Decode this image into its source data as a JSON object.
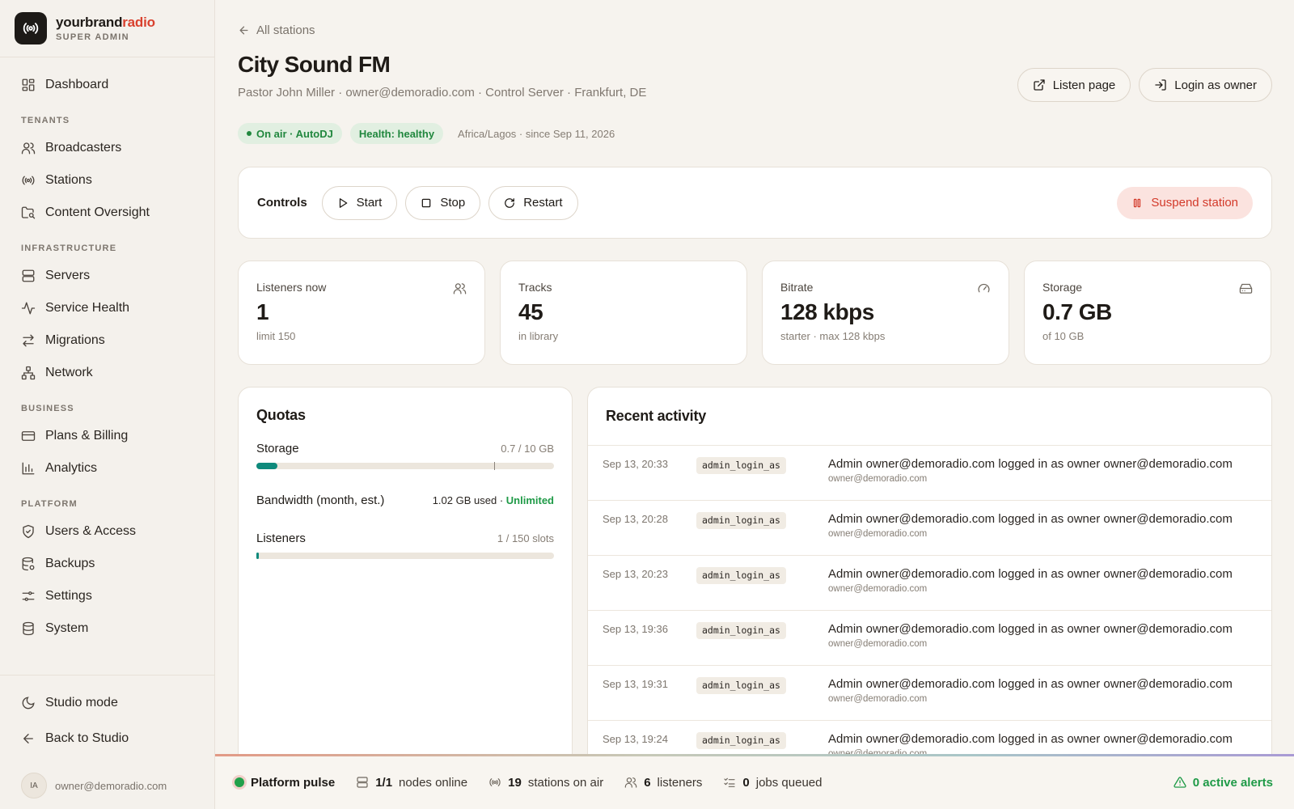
{
  "brand": {
    "name_main": "yourbrand",
    "name_accent": "radio",
    "role": "SUPER ADMIN"
  },
  "sidebar": {
    "top": [
      {
        "label": "Dashboard",
        "icon": "grid-icon"
      }
    ],
    "sections": [
      {
        "title": "TENANTS",
        "items": [
          {
            "label": "Broadcasters",
            "icon": "users-icon"
          },
          {
            "label": "Stations",
            "icon": "radio-icon"
          },
          {
            "label": "Content Oversight",
            "icon": "folder-search-icon"
          }
        ]
      },
      {
        "title": "INFRASTRUCTURE",
        "items": [
          {
            "label": "Servers",
            "icon": "server-icon"
          },
          {
            "label": "Service Health",
            "icon": "activity-icon"
          },
          {
            "label": "Migrations",
            "icon": "arrows-swap-icon"
          },
          {
            "label": "Network",
            "icon": "network-icon"
          }
        ]
      },
      {
        "title": "BUSINESS",
        "items": [
          {
            "label": "Plans & Billing",
            "icon": "credit-card-icon"
          },
          {
            "label": "Analytics",
            "icon": "bar-chart-icon"
          }
        ]
      },
      {
        "title": "PLATFORM",
        "items": [
          {
            "label": "Users & Access",
            "icon": "shield-icon"
          },
          {
            "label": "Backups",
            "icon": "database-backup-icon"
          },
          {
            "label": "Settings",
            "icon": "sliders-icon"
          },
          {
            "label": "System",
            "icon": "database-icon"
          }
        ]
      }
    ],
    "bottom": [
      {
        "label": "Studio mode",
        "icon": "moon-icon"
      },
      {
        "label": "Back to Studio",
        "icon": "arrow-left-icon"
      }
    ],
    "user": {
      "initials": "IA",
      "email": "owner@demoradio.com"
    }
  },
  "page": {
    "back_label": "All stations",
    "title": "City Sound FM",
    "subtitle": "Pastor John Miller · owner@demoradio.com · Control Server · Frankfurt, DE",
    "actions": {
      "listen": "Listen page",
      "login_as": "Login as owner"
    },
    "badges": {
      "on_air": "On air · AutoDJ",
      "health": "Health: healthy",
      "timezone": "Africa/Lagos · since Sep 11, 2026"
    },
    "controls": {
      "label": "Controls",
      "start": "Start",
      "stop": "Stop",
      "restart": "Restart",
      "suspend": "Suspend station"
    }
  },
  "stats": [
    {
      "label": "Listeners now",
      "value": "1",
      "sub": "limit 150",
      "icon": "users-icon"
    },
    {
      "label": "Tracks",
      "value": "45",
      "sub": "in library",
      "icon": ""
    },
    {
      "label": "Bitrate",
      "value": "128 kbps",
      "sub": "starter · max 128 kbps",
      "icon": "gauge-icon"
    },
    {
      "label": "Storage",
      "value": "0.7 GB",
      "sub": "of 10 GB",
      "icon": "hard-drive-icon"
    }
  ],
  "quotas": {
    "title": "Quotas",
    "storage": {
      "name": "Storage",
      "value": "0.7 / 10 GB",
      "fill_fraction": 0.07,
      "marker_fraction": 0.8
    },
    "bandwidth": {
      "name": "Bandwidth (month, est.)",
      "used": "1.02 GB used",
      "sep": " · ",
      "limit": "Unlimited"
    },
    "listeners": {
      "name": "Listeners",
      "value": "1 / 150 slots",
      "fill_fraction": 0.0067
    }
  },
  "activity": {
    "title": "Recent activity",
    "rows": [
      {
        "time": "Sep 13, 20:33",
        "code": "admin_login_as",
        "text": "Admin owner@demoradio.com logged in as owner owner@demoradio.com",
        "sub": "owner@demoradio.com"
      },
      {
        "time": "Sep 13, 20:28",
        "code": "admin_login_as",
        "text": "Admin owner@demoradio.com logged in as owner owner@demoradio.com",
        "sub": "owner@demoradio.com"
      },
      {
        "time": "Sep 13, 20:23",
        "code": "admin_login_as",
        "text": "Admin owner@demoradio.com logged in as owner owner@demoradio.com",
        "sub": "owner@demoradio.com"
      },
      {
        "time": "Sep 13, 19:36",
        "code": "admin_login_as",
        "text": "Admin owner@demoradio.com logged in as owner owner@demoradio.com",
        "sub": "owner@demoradio.com"
      },
      {
        "time": "Sep 13, 19:31",
        "code": "admin_login_as",
        "text": "Admin owner@demoradio.com logged in as owner owner@demoradio.com",
        "sub": "owner@demoradio.com"
      },
      {
        "time": "Sep 13, 19:24",
        "code": "admin_login_as",
        "text": "Admin owner@demoradio.com logged in as owner owner@demoradio.com",
        "sub": "owner@demoradio.com"
      }
    ]
  },
  "pulse": {
    "title": "Platform pulse",
    "nodes_value": "1/1",
    "nodes_label": "nodes online",
    "stations_value": "19",
    "stations_label": "stations on air",
    "listeners_value": "6",
    "listeners_label": "listeners",
    "jobs_value": "0",
    "jobs_label": "jobs queued",
    "alerts": "0 active alerts"
  },
  "colors": {
    "accent": "#d9412e",
    "success": "#21873e",
    "danger": "#d33a2a",
    "teal": "#0f8a7c"
  }
}
